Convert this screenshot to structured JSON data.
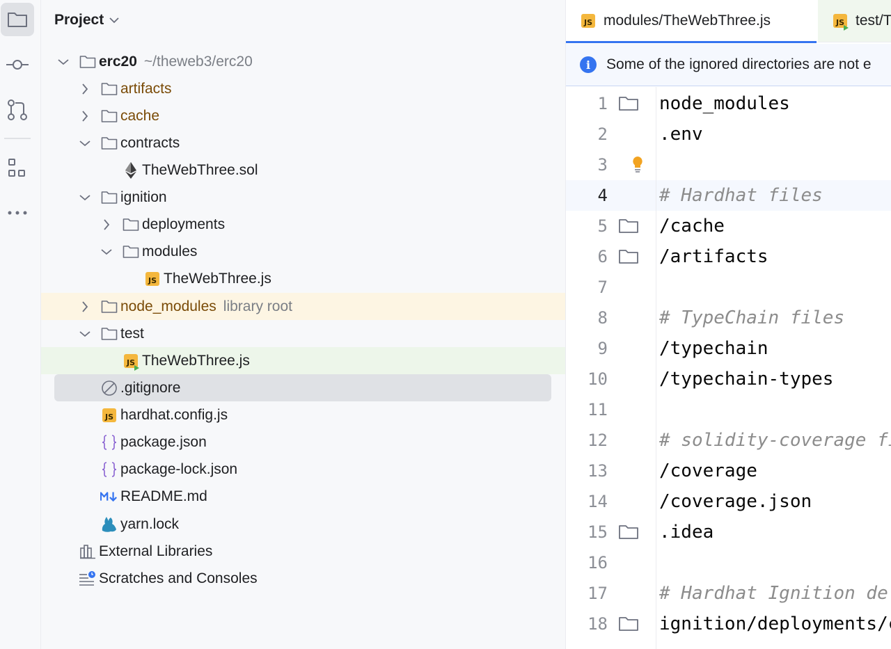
{
  "toolstrip": {
    "items": [
      {
        "icon": "folder-icon",
        "active": true
      },
      {
        "icon": "commit-icon",
        "active": false
      },
      {
        "icon": "pull-request-icon",
        "active": false
      },
      {
        "icon": "structure-icon",
        "active": false
      },
      {
        "icon": "more-icon",
        "active": false
      }
    ]
  },
  "project": {
    "title": "Project",
    "tree": [
      {
        "label": "erc20",
        "hint": "~/theweb3/erc20",
        "icon": "folder-icon",
        "expanded": true
      },
      {
        "label": "artifacts",
        "icon": "folder-icon",
        "expanded": false
      },
      {
        "label": "cache",
        "icon": "folder-icon",
        "expanded": false
      },
      {
        "label": "contracts",
        "icon": "folder-icon",
        "expanded": true
      },
      {
        "label": "TheWebThree.sol",
        "icon": "ethereum-icon"
      },
      {
        "label": "ignition",
        "icon": "folder-icon",
        "expanded": true
      },
      {
        "label": "deployments",
        "icon": "folder-icon",
        "expanded": false
      },
      {
        "label": "modules",
        "icon": "folder-icon",
        "expanded": true
      },
      {
        "label": "TheWebThree.js",
        "icon": "js-file-icon"
      },
      {
        "label": "node_modules",
        "hint": "library root",
        "icon": "folder-icon",
        "expanded": false
      },
      {
        "label": "test",
        "icon": "folder-icon",
        "expanded": true
      },
      {
        "label": "TheWebThree.js",
        "icon": "js-test-file-icon"
      },
      {
        "label": ".gitignore",
        "icon": "ignore-file-icon"
      },
      {
        "label": "hardhat.config.js",
        "icon": "js-file-icon"
      },
      {
        "label": "package.json",
        "icon": "json-file-icon"
      },
      {
        "label": "package-lock.json",
        "icon": "json-file-icon"
      },
      {
        "label": "README.md",
        "icon": "markdown-icon"
      },
      {
        "label": "yarn.lock",
        "icon": "yarn-icon"
      },
      {
        "label": "External Libraries",
        "icon": "library-icon"
      },
      {
        "label": "Scratches and Consoles",
        "icon": "scratches-icon"
      }
    ]
  },
  "editor": {
    "tabs": [
      {
        "label": "modules/TheWebThree.js",
        "icon": "js-file-icon",
        "active": true
      },
      {
        "label": "test/T",
        "icon": "js-test-file-icon",
        "active": false
      }
    ],
    "notice": "Some of the ignored directories are not e",
    "js_badge": "JS",
    "lines": [
      {
        "n": "1",
        "text": "node_modules",
        "folder": true
      },
      {
        "n": "2",
        "text": ".env"
      },
      {
        "n": "3",
        "text": "",
        "bulb": true
      },
      {
        "n": "4",
        "text": "# Hardhat files",
        "comment": true,
        "current": true
      },
      {
        "n": "5",
        "text": "/cache",
        "folder": true
      },
      {
        "n": "6",
        "text": "/artifacts",
        "folder": true
      },
      {
        "n": "7",
        "text": ""
      },
      {
        "n": "8",
        "text": "# TypeChain files",
        "comment": true
      },
      {
        "n": "9",
        "text": "/typechain"
      },
      {
        "n": "10",
        "text": "/typechain-types"
      },
      {
        "n": "11",
        "text": ""
      },
      {
        "n": "12",
        "text": "# solidity-coverage fi",
        "comment": true
      },
      {
        "n": "13",
        "text": "/coverage"
      },
      {
        "n": "14",
        "text": "/coverage.json"
      },
      {
        "n": "15",
        "text": ".idea",
        "folder": true
      },
      {
        "n": "16",
        "text": ""
      },
      {
        "n": "17",
        "text": "# Hardhat Ignition de",
        "comment": true
      },
      {
        "n": "18",
        "text": "ignition/deployments/c",
        "folder": true
      }
    ]
  },
  "colors": {
    "accent": "#3574f0",
    "js_badge": "#f4b73d",
    "excluded_folder": "#7a4b07"
  }
}
